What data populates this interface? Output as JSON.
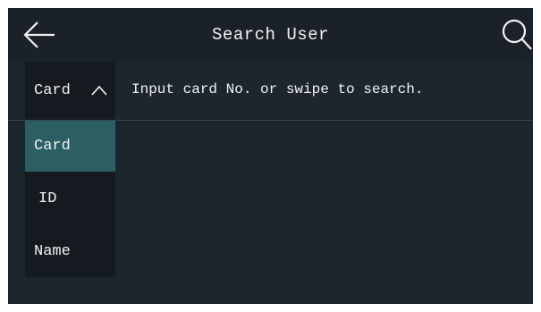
{
  "header": {
    "title": "Search User",
    "back_icon": "arrow-left-icon",
    "search_icon": "search-icon"
  },
  "search": {
    "type_selected": "Card",
    "hint": "Input card No. or swipe to search."
  },
  "dropdown": {
    "items": [
      {
        "label": "Card",
        "selected": true
      },
      {
        "label": "ID",
        "selected": false
      },
      {
        "label": "Name",
        "selected": false
      }
    ]
  },
  "colors": {
    "background": "#1d252d",
    "header": "#1b2128",
    "dropdown_bg": "#141a1f",
    "selected_item": "#2b5f64",
    "text": "#f2f2f2"
  }
}
